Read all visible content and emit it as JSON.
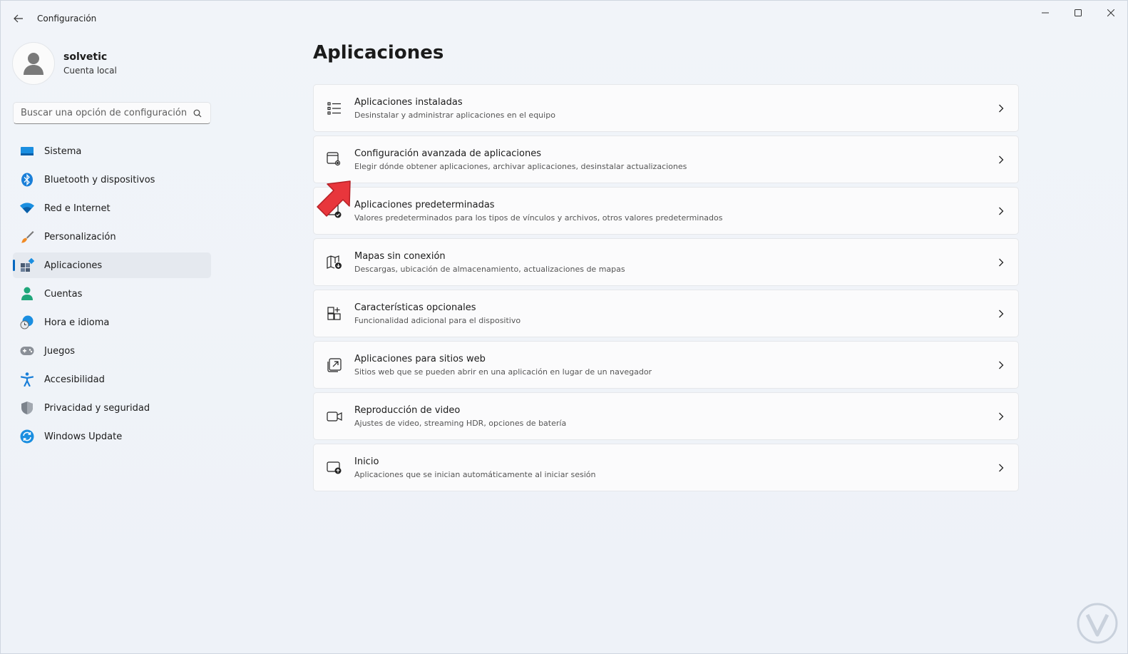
{
  "window": {
    "title": "Configuración",
    "controls": {
      "minimize": "minimize-icon",
      "maximize": "maximize-icon",
      "close": "close-icon"
    }
  },
  "profile": {
    "name": "solvetic",
    "subtitle": "Cuenta local"
  },
  "search": {
    "placeholder": "Buscar una opción de configuración"
  },
  "sidebar": {
    "items": [
      {
        "label": "Sistema",
        "icon": "monitor-icon",
        "active": false
      },
      {
        "label": "Bluetooth y dispositivos",
        "icon": "bluetooth-icon",
        "active": false
      },
      {
        "label": "Red e Internet",
        "icon": "wifi-icon",
        "active": false
      },
      {
        "label": "Personalización",
        "icon": "brush-icon",
        "active": false
      },
      {
        "label": "Aplicaciones",
        "icon": "apps-icon",
        "active": true
      },
      {
        "label": "Cuentas",
        "icon": "person-icon",
        "active": false
      },
      {
        "label": "Hora e idioma",
        "icon": "globe-clock-icon",
        "active": false
      },
      {
        "label": "Juegos",
        "icon": "gamepad-icon",
        "active": false
      },
      {
        "label": "Accesibilidad",
        "icon": "accessibility-icon",
        "active": false
      },
      {
        "label": "Privacidad y seguridad",
        "icon": "shield-icon",
        "active": false
      },
      {
        "label": "Windows Update",
        "icon": "sync-icon",
        "active": false
      }
    ]
  },
  "main": {
    "title": "Aplicaciones",
    "cards": [
      {
        "title": "Aplicaciones instaladas",
        "subtitle": "Desinstalar y administrar aplicaciones en el equipo",
        "icon": "list-icon"
      },
      {
        "title": "Configuración avanzada de aplicaciones",
        "subtitle": "Elegir dónde obtener aplicaciones, archivar aplicaciones, desinstalar actualizaciones",
        "icon": "app-settings-icon"
      },
      {
        "title": "Aplicaciones predeterminadas",
        "subtitle": "Valores predeterminados para los tipos de vínculos y archivos, otros valores predeterminados",
        "icon": "default-apps-icon"
      },
      {
        "title": "Mapas sin conexión",
        "subtitle": "Descargas, ubicación de almacenamiento, actualizaciones de mapas",
        "icon": "map-download-icon"
      },
      {
        "title": "Características opcionales",
        "subtitle": "Funcionalidad adicional para el dispositivo",
        "icon": "grid-add-icon"
      },
      {
        "title": "Aplicaciones para sitios web",
        "subtitle": "Sitios web que se pueden abrir en una aplicación en lugar de un navegador",
        "icon": "open-external-icon"
      },
      {
        "title": "Reproducción de video",
        "subtitle": "Ajustes de video, streaming HDR, opciones de batería",
        "icon": "video-icon"
      },
      {
        "title": "Inicio",
        "subtitle": "Aplicaciones que se inician automáticamente al iniciar sesión",
        "icon": "startup-icon"
      }
    ]
  },
  "colors": {
    "accent": "#0067c0",
    "annotation": "#e8363c"
  }
}
